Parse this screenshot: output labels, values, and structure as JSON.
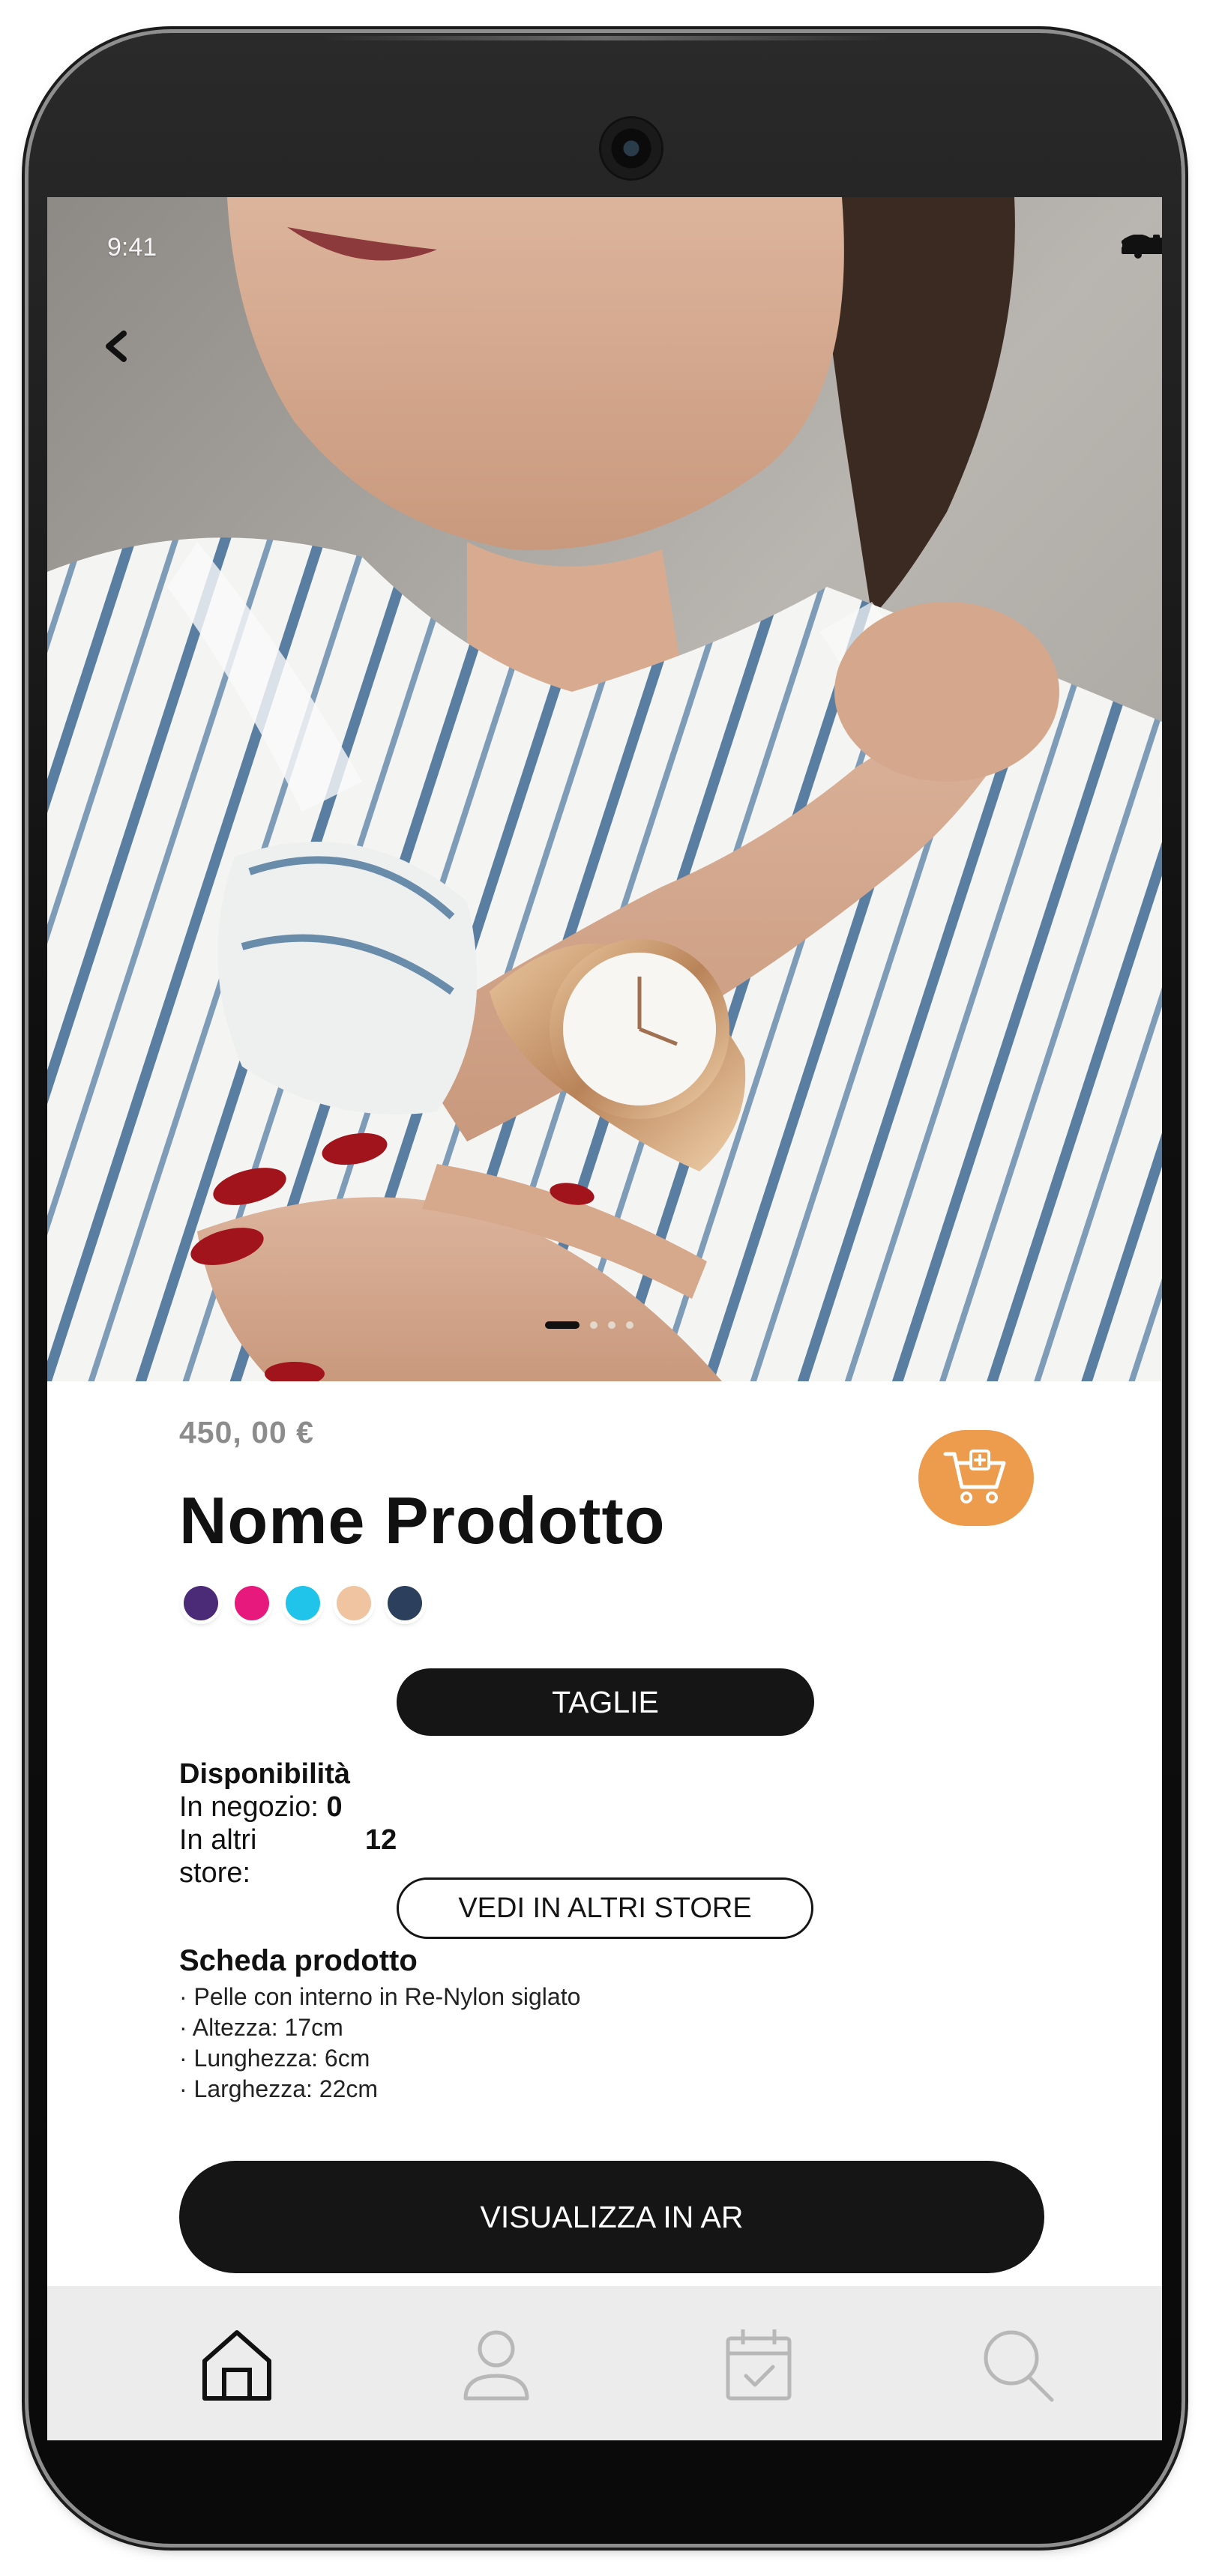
{
  "status_bar": {
    "time": "9:41"
  },
  "product": {
    "price": "450, 00 €",
    "name": "Nome Prodotto",
    "colors": [
      "#4b2a78",
      "#e8197c",
      "#20c3ea",
      "#f0c4a1",
      "#2c3f5c"
    ]
  },
  "buttons": {
    "sizes_label": "TAGLIE",
    "other_stores_label": "VEDI IN ALTRI STORE",
    "ar_label": "VISUALIZZA IN AR"
  },
  "availability": {
    "title": "Disponibilità",
    "in_store_label": "In negozio:",
    "in_store_value": "0",
    "other_stores_label_line1": "In altri",
    "other_stores_label_line2": "store:",
    "other_stores_value": "12"
  },
  "product_sheet": {
    "title": "Scheda prodotto",
    "items": [
      "· Pelle con interno in Re-Nylon siglato",
      "· Altezza: 17cm",
      "· Lunghezza: 6cm",
      "· Larghezza: 22cm"
    ]
  },
  "carousel": {
    "current": 1,
    "total": 4
  },
  "icons": {
    "back": "chevron-left-icon",
    "cart": "cart-add-icon",
    "nav": [
      "home-icon",
      "user-icon",
      "calendar-check-icon",
      "search-icon"
    ]
  },
  "theme": {
    "accent": "#ed9b4c",
    "dark": "#151515",
    "nav_bg": "#ececec"
  }
}
